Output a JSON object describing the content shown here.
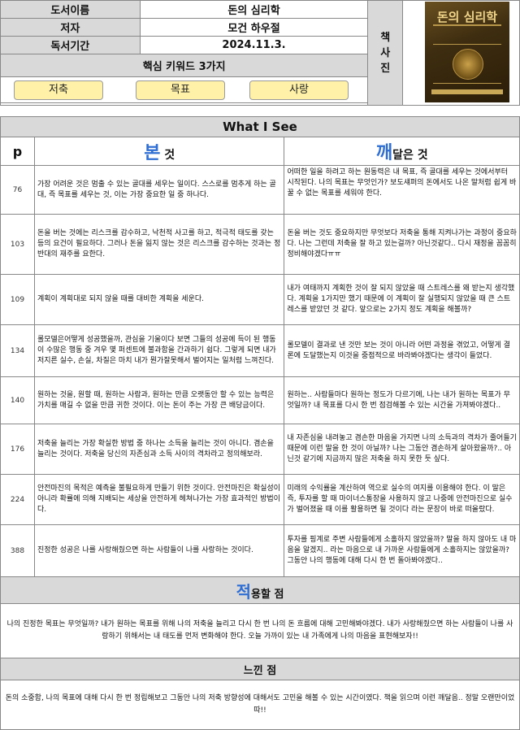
{
  "header": {
    "book_title_label": "도서이름",
    "book_title": "돈의 심리학",
    "author_label": "저자",
    "author": "모건 하우절",
    "period_label": "독서기간",
    "period": "2024.11.3.",
    "photo_label": "책\n사\n진",
    "keywords_label": "핵심 키워드 3가지",
    "keywords": [
      "저축",
      "목표",
      "사랑"
    ]
  },
  "cover": {
    "title": "돈의 심리학"
  },
  "main": {
    "title": "What I See",
    "p_label": "p",
    "seen_big": "본",
    "seen_small": " 것",
    "realized_big": "깨",
    "realized_small": "달은 것",
    "rows": [
      {
        "p": "76",
        "seen": "가장 어려운 것은 멈출 수 있는 골대를 세우는 일이다. 스스로를 멈추게 하는 골대, 즉 목표를 세우는 것, 이는 가장 중요한 일 중 하나다.",
        "realized": "어떠한 일을 하려고 하는 원동력은 내 목표, 즉 골대를 세우는 것에서부터 시작된다. 나의 목표는 무엇인가? 보도섀퍼의 돈에서도 나온 말처럼 쉽게 바꿀 수 없는 목표를 세워야 한다."
      },
      {
        "p": "103",
        "seen": "돈을 버는 것에는 리스크를 감수하고, 낙천적 사고를 하고, 적극적 태도를 갖는 등의 요건이 필요하다. 그러나 돈을 잃지 않는 것은 리스크를 감수하는 것과는 정반대의 재주를 요한다.",
        "realized": "돈을 버는 것도 중요하지만 무엇보다 저축을 통해 지켜나가는 과정이 중요하다. 나는 그런데 저축을 잘 하고 있는걸까? 아닌것같다.. 다시 재정을 꼼꼼히 정비해야겠다ㅠㅠ"
      },
      {
        "p": "109",
        "seen": "계획이 계획대로 되지 않을 때를 대비한 계획을 세운다.",
        "realized": "내가 여태까지 계획한 것이 잘 되지 않았을 때 스트레스를 왜 받는지 생각했다. 계획을 1가지만 했기 때문에 이 계획이 잘 실행되지 않았을 때 큰 스트레스를 받았던 것 같다. 앞으로는 2가지 정도 계획을 해볼까?"
      },
      {
        "p": "134",
        "seen": "롤모델은어떻게 성공했을까, 관심을 기울이다 보면 그들의 성공에 득이 된 행동이 수많은 행동 중 겨우 몇 퍼센트에 불과함을 간과하기 쉽다. 그렇게 되면 내가 저지른 실수, 손실, 차질은 마치 내가 뭔가잘못해서 벌어지는 일처럼 느껴진다.",
        "realized": "롤모델이 결과로 낸 것만 보는 것이 아니라 어떤 과정을 겪었고, 어떻게 결론에 도달했는지 이것을 중점적으로 바라봐야겠다는 생각이 들었다."
      },
      {
        "p": "140",
        "seen": "원하는 것을, 원할 때, 원하는 사람과, 원하는 만큼 오랫동안 할 수 있는 능력은 가치를 매길 수 없을 만큼 귀한 것이다. 이는 돈이 주는 가장 큰 배당금이다.",
        "realized": "원하는.. 사람들마다 원하는 정도가 다르기에, 나는 내가 원하는 목표가 무엇일까? 내 목표를 다시 한 번 점검해볼 수 있는 시간을 가져봐야겠다.."
      },
      {
        "p": "176",
        "seen": "저축을 늘리는 가장 확실한 방법 중 하나는 소득을 늘리는 것이 아니다. 겸손을 늘리는 것이다. 저축을 당신의 자존심과 소득 사이의 격차라고 정의해보라.",
        "realized": "내 자존심을 내려놓고 겸손한 마음을 가지면 나의 소득과의 격차가 줄어들기 때문에 이런 말을 한 것이 아닐까? 나는 그동안 겸손하게 살아왔을까?.. 아닌것 같기에 지금까지 많은 저축을 하지 못한 듯 싶다."
      },
      {
        "p": "224",
        "seen": "안전마진의 목적은 예측을 불필요하게 만들기 위한 것이다. 안전마진은 확실성이 아니라 확률에 의해 지배되는 세상을 안전하게 헤쳐나가는 가장 효과적인 방법이다.",
        "realized": "미래의 수익률을 계산하여 역으로 실수의 여지를 이용해야 한다. 이 말은 즉, 투자를 할 때 마이너스통장을 사용하지 않고 나중에 안전마진으로 실수가 벌어졌을 때 이를 활용하면 될 것이다 라는 문장이 바로 떠올랐다."
      },
      {
        "p": "388",
        "seen": "진정한 성공은 나를 사랑해줬으면 하는 사람들이 나를 사랑하는 것이다.",
        "realized": "투자를 핑계로 주변 사람들에게 소홀하지 않았을까? 말을 하지 않아도 내 마음을 알겠지.. 라는 마음으로 내 가까운 사람들에게 소홀하지는 않았을까? 그동안 나의 행동에 대해 다시 한 번 돌아봐야겠다.."
      }
    ]
  },
  "apply": {
    "title_big": "적",
    "title_small": "용할 점",
    "body": "나의 진정한 목표는 무엇일까? 내가 원하는 목표를 위해 나의 저축을 늘리고 다시 한 번 나의 돈 흐름에 대해 고민해봐야겠다. 내가 사랑해줬으면 하는 사람들이 나를 사랑하기 위해서는 내 태도를 먼저 변화해야 한다. 오늘 가까이 있는 내 가족에게 나의 마음을 표현해보자!!"
  },
  "felt": {
    "title": "느낀 점",
    "body": "돈의 소중함, 나의 목표에 대해 다시 한 번 정립해보고 그동안 나의 저축 방향성에 대해서도 고민을 해볼 수 있는 시간이였다. 책을 읽으며 이런 깨달음.. 정말 오랜만이었따!!"
  }
}
